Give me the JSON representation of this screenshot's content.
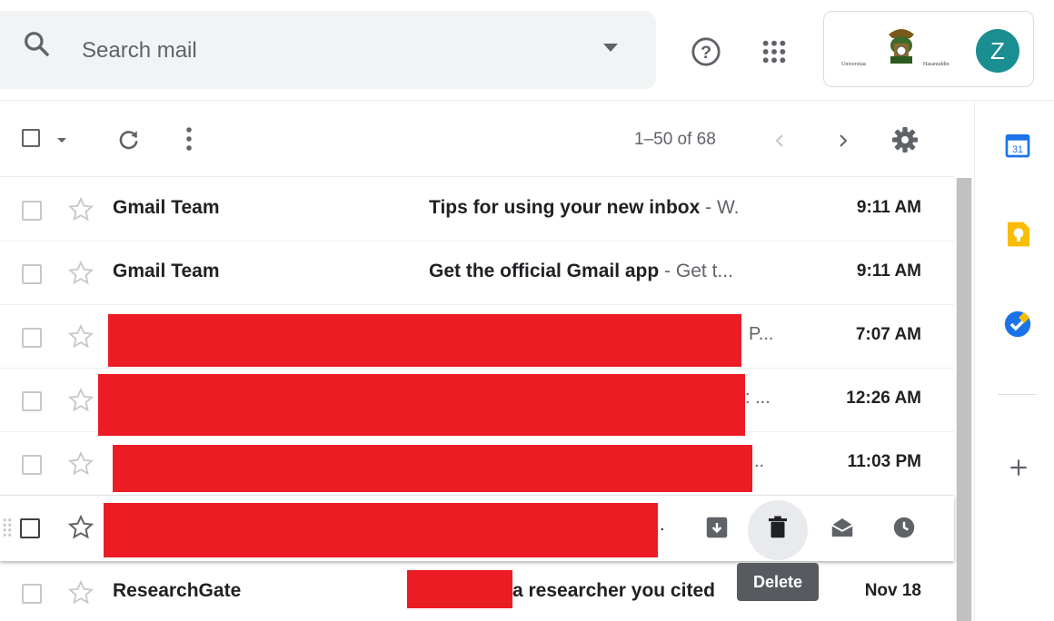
{
  "header": {
    "search_placeholder": "Search mail",
    "avatar_letter": "Z",
    "logo_left_text": "Universitas",
    "logo_right_text": "Hasanuddin"
  },
  "toolbar": {
    "pagination": "1–50 of 68"
  },
  "emails": [
    {
      "sender": "Gmail Team",
      "subject": "Tips for using your new inbox",
      "snippet": " - W.",
      "time": "9:11 AM"
    },
    {
      "sender": "Gmail Team",
      "subject": "Get the official Gmail app",
      "snippet": " - Get t...",
      "time": "9:11 AM"
    },
    {
      "sender": "",
      "subject": "",
      "tail": "P...",
      "time": "7:07 AM"
    },
    {
      "sender": "",
      "subject": "",
      "tail": ": ...",
      "time": "12:26 AM"
    },
    {
      "sender": "",
      "subject": "",
      "tail": "..",
      "time": "11:03 PM"
    },
    {
      "sender": "",
      "subject": "",
      "tail": ".",
      "time": ""
    },
    {
      "sender": "ResearchGate",
      "subject": "a researcher you cited",
      "time": "Nov 18"
    }
  ],
  "tooltip": "Delete",
  "colors": {
    "redaction": "#ec1c24",
    "avatar": "#1a8e91",
    "calendar": "#1a73e8",
    "keep": "#fbbc04",
    "tasks": "#1a73e8"
  }
}
